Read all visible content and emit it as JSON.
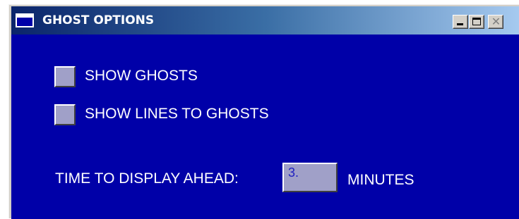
{
  "window": {
    "title": "GHOST OPTIONS",
    "title_icon": "window-icon",
    "controls": {
      "minimize_icon": "minimize-icon",
      "maximize_icon": "maximize-icon",
      "close_icon": "close-icon",
      "close_glyph": "✕"
    }
  },
  "options": {
    "show_ghosts": {
      "label": "SHOW GHOSTS",
      "checked": false
    },
    "show_lines": {
      "label": "SHOW LINES TO GHOSTS",
      "checked": false
    }
  },
  "time_ahead": {
    "label": "TIME TO DISPLAY AHEAD:",
    "value": "3.",
    "unit": "MINUTES"
  },
  "colors": {
    "client_background": "#0000a8",
    "title_gradient_start": "#0a246a",
    "title_gradient_end": "#a6caf0",
    "control_face": "#a0a0c8",
    "input_text": "#2020c0",
    "label_text": "#ffffff"
  }
}
